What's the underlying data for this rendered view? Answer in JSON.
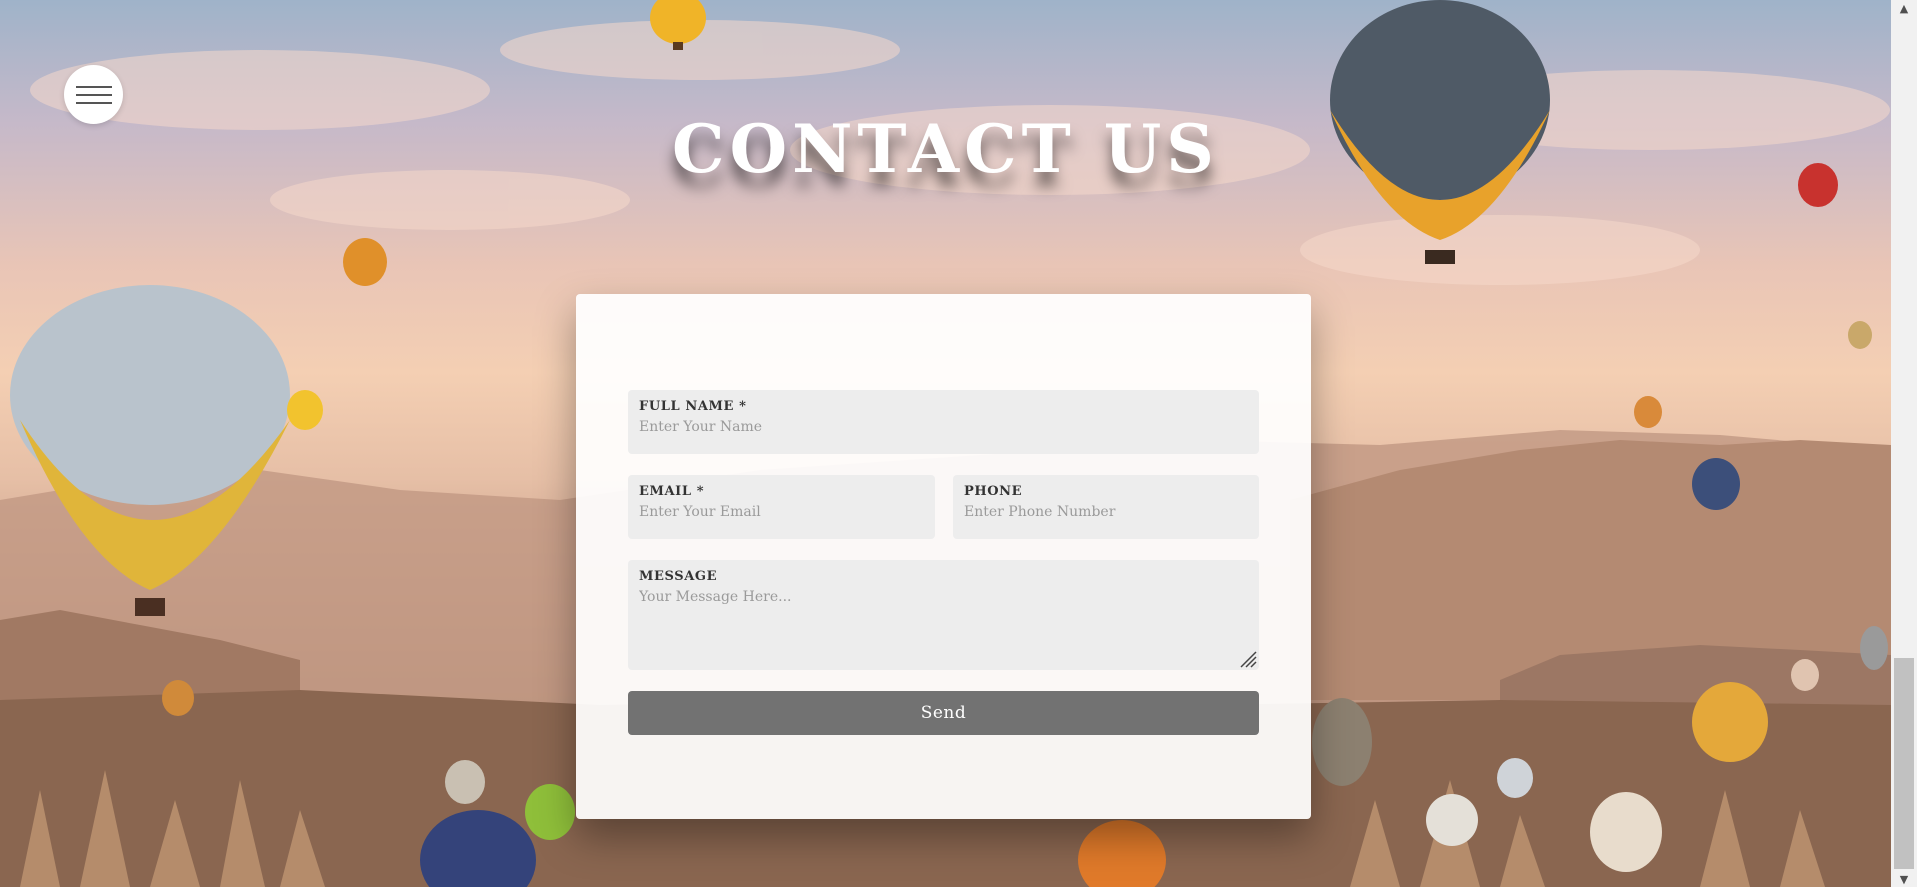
{
  "page": {
    "title": "CONTACT US"
  },
  "nav": {
    "menu_icon": "hamburger-menu-icon"
  },
  "form": {
    "full_name": {
      "label": "FULL NAME *",
      "placeholder": "Enter Your Name",
      "value": ""
    },
    "email": {
      "label": "EMAIL *",
      "placeholder": "Enter Your Email",
      "value": ""
    },
    "phone": {
      "label": "PHONE",
      "placeholder": "Enter Phone Number",
      "value": ""
    },
    "message": {
      "label": "MESSAGE",
      "placeholder": "Your Message Here...",
      "value": ""
    },
    "send_label": "Send"
  },
  "scrollbar": {
    "up_icon": "chevron-up-icon",
    "down_icon": "chevron-down-icon"
  },
  "colors": {
    "card_background": "#ffffff",
    "field_background": "#ededed",
    "button_background": "#727272",
    "title_color": "#ffffff"
  }
}
